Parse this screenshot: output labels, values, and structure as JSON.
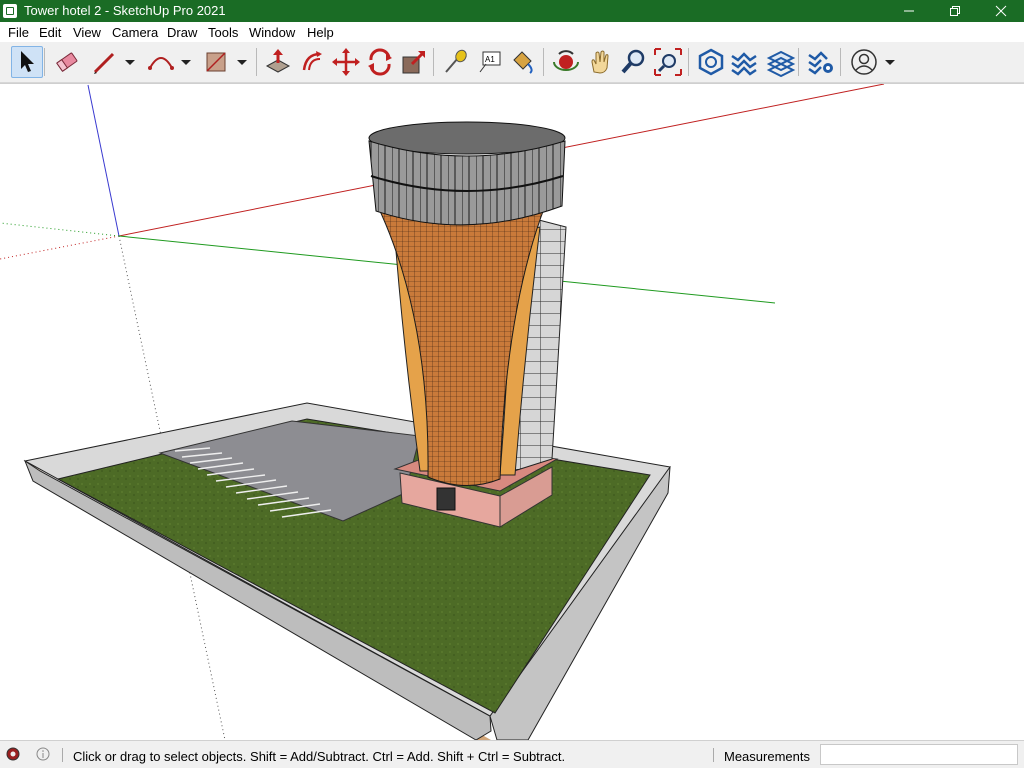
{
  "window": {
    "title": "Tower hotel 2 - SketchUp Pro 2021"
  },
  "menu": [
    "File",
    "Edit",
    "View",
    "Camera",
    "Draw",
    "Tools",
    "Window",
    "Help"
  ],
  "toolbar": {
    "tools": [
      {
        "icon": "select-arrow-icon",
        "active": true
      },
      {
        "icon": "eraser-icon"
      },
      {
        "icon": "pencil-line-icon"
      },
      {
        "icon": "dropdown-chevron-icon"
      },
      {
        "icon": "arc-icon"
      },
      {
        "icon": "dropdown-chevron-icon"
      },
      {
        "icon": "rectangle-icon"
      },
      {
        "icon": "dropdown-chevron-icon"
      },
      {
        "icon": "push-pull-icon"
      },
      {
        "icon": "offset-icon"
      },
      {
        "icon": "move-icon"
      },
      {
        "icon": "rotate-icon"
      },
      {
        "icon": "scale-icon"
      },
      {
        "icon": "tape-measure-icon"
      },
      {
        "icon": "text-icon"
      },
      {
        "icon": "paint-bucket-icon"
      },
      {
        "icon": "orbit-icon"
      },
      {
        "icon": "pan-hand-icon"
      },
      {
        "icon": "zoom-icon"
      },
      {
        "icon": "zoom-extents-icon"
      },
      {
        "icon": "3d-warehouse-icon"
      },
      {
        "icon": "extension-warehouse-icon"
      },
      {
        "icon": "layout-icon"
      },
      {
        "icon": "extension-manager-icon"
      },
      {
        "icon": "account-icon"
      },
      {
        "icon": "dropdown-chevron-icon"
      }
    ]
  },
  "status": {
    "hint": "Click or drag to select objects. Shift = Add/Subtract. Ctrl = Add. Shift + Ctrl = Subtract.",
    "measurements_label": "Measurements",
    "measurements_value": ""
  },
  "colors": {
    "titlebar": "#1a6c25",
    "grass": "#4d6b26",
    "parking": "#8d8d92",
    "tower_brick": "#c97a3a",
    "tower_panel": "#e5a24a",
    "base_pink": "#e6a79e",
    "slab_edge": "#b0b0b0"
  }
}
